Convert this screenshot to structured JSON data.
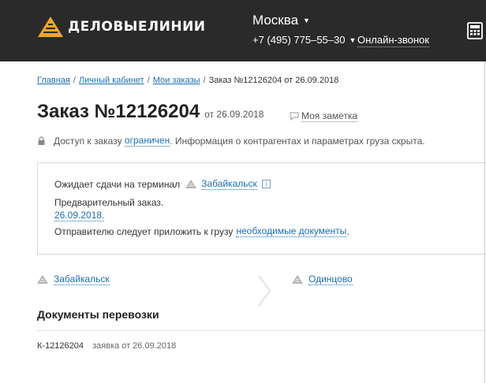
{
  "header": {
    "logo_text": "ДЕЛОВЫЕЛИНИИ",
    "city": "Москва",
    "phone": "+7 (495) 775–55–30",
    "callback": "Онлайн-звонок"
  },
  "breadcrumb": {
    "items": [
      "Главная",
      "Личный кабинет",
      "Мои заказы"
    ],
    "current": "Заказ №12126204 от 26.09.2018"
  },
  "order": {
    "title": "Заказ №12126204",
    "date_text": "от 26.09.2018",
    "note_link": "Моя заметка"
  },
  "access": {
    "prefix": "Доступ к заказу",
    "link": "ограничен",
    "suffix": ". Информация о контрагентах и параметрах груза скрыта."
  },
  "status": {
    "line1": "Ожидает сдачи на терминал",
    "terminal": "Забайкальск",
    "line2": "Предварительный заказ.",
    "date_link": "26.09.2018.",
    "line4_prefix": "Отправителю следует приложить к грузу",
    "docs_link": "необходимые документы",
    "line4_suffix": "."
  },
  "route": {
    "from": "Забайкальск",
    "to": "Одинцово"
  },
  "documents": {
    "heading": "Документы перевозки",
    "items": [
      {
        "id": "К-12126204",
        "type": "заявка от 26.09.2018"
      }
    ]
  }
}
